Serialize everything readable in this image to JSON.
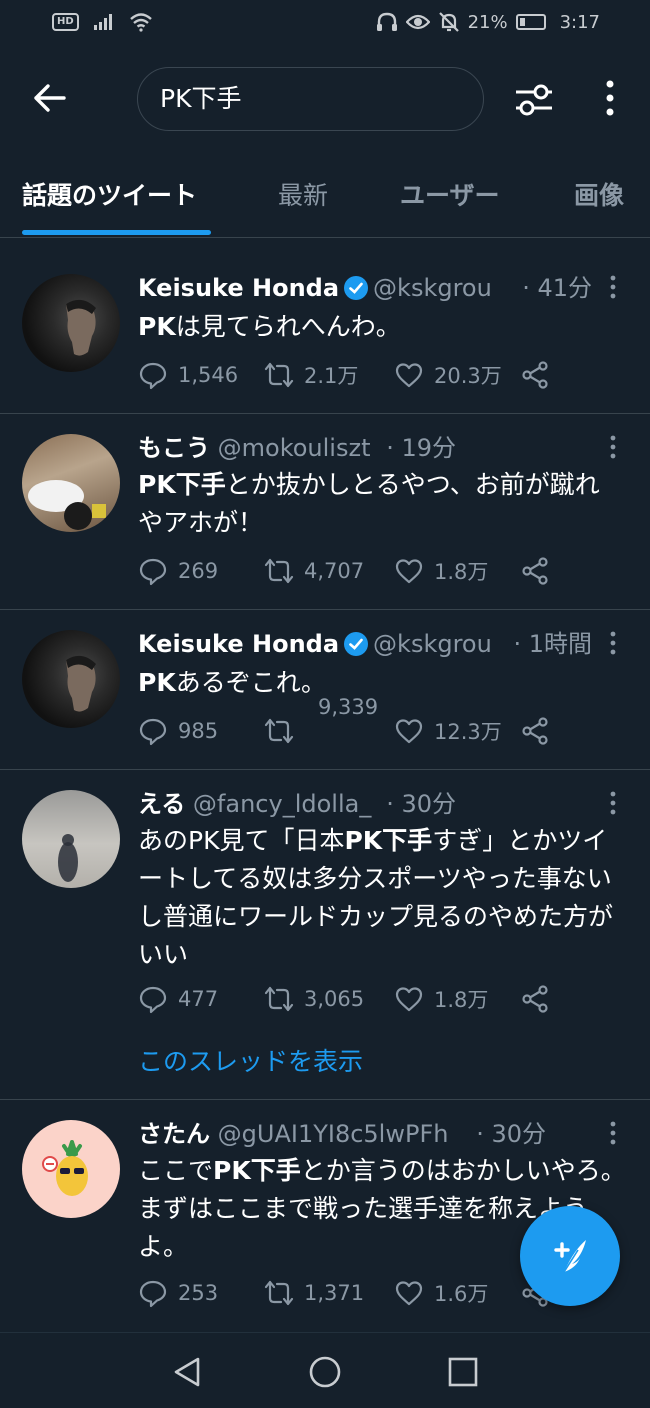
{
  "status_bar": {
    "network_badge": "HD",
    "battery_percent": "21%",
    "battery_level": 0.21,
    "time": "3:17"
  },
  "header": {
    "search_query": "PK下手"
  },
  "tabs": [
    {
      "label": "話題のツイート",
      "active": true
    },
    {
      "label": "最新",
      "active": false
    },
    {
      "label": "ユーザー",
      "active": false
    },
    {
      "label": "画像",
      "active": false
    }
  ],
  "tweets": [
    {
      "name": "Keisuke Honda",
      "verified": true,
      "handle": "@kskgrou…",
      "time": "· 41分",
      "text_bold": "PK",
      "text_rest": "は見てられへんわ。",
      "replies": "1,546",
      "retweets": "2.1万",
      "likes": "20.3万"
    },
    {
      "name": "もこう",
      "verified": false,
      "handle": "@mokouliszt",
      "time": "· 19分",
      "text_bold": "PK下手",
      "text_rest": "とか抜かしとるやつ、お前が蹴れやアホが！",
      "replies": "269",
      "retweets": "4,707",
      "likes": "1.8万"
    },
    {
      "name": "Keisuke Honda",
      "verified": true,
      "handle": "@kskgrou…",
      "time": "· 1時間",
      "text_bold": "PK",
      "text_rest": "あるぞこれ。",
      "replies": "985",
      "retweets": "9,339",
      "likes": "12.3万"
    },
    {
      "name": "える",
      "verified": false,
      "handle": "@fancy_ldolla_",
      "time": "· 30分",
      "text_pre": "あのPK見て「日本",
      "text_bold": "PK下手",
      "text_rest": "すぎ」とかツイートしてる奴は多分スポーツやった事ないし普通にワールドカップ見るのやめた方がいい",
      "replies": "477",
      "retweets": "3,065",
      "likes": "1.8万",
      "thread_link": "このスレッドを表示"
    },
    {
      "name": "さたん",
      "verified": false,
      "handle": "@gUAI1YI8c5lwPFh",
      "time": "· 30分",
      "text_pre": "ここで",
      "text_bold": "PK下手",
      "text_rest": "とか言うのはおかしいやろ。まずはここまで戦った選手達を称えようよ。",
      "replies": "253",
      "retweets": "1,371",
      "likes": "1.6万"
    }
  ],
  "colors": {
    "background": "#15202b",
    "accent": "#1d9bf0",
    "muted": "#8b98a5",
    "divider": "#38444d"
  }
}
